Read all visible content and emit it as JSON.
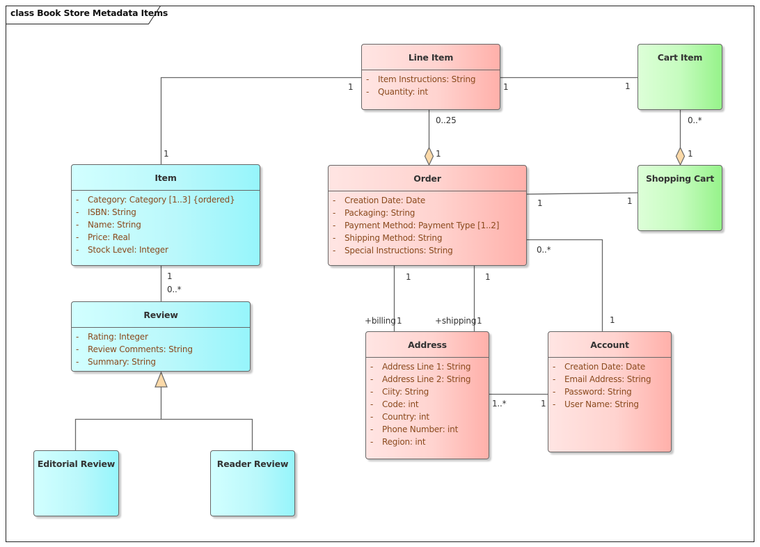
{
  "diagram": {
    "title": "class Book Store Metadata Items",
    "colors": {
      "entity_red": "#ffb0aa",
      "entity_teal": "#96f5fb",
      "entity_green": "#96f38a",
      "attribute_text": "#8a4a1e",
      "connector": "#666666",
      "aggregation_diamond": "#fbd9a8"
    }
  },
  "classes": {
    "line_item": {
      "name": "Line Item",
      "attributes": [
        {
          "vis": "-",
          "text": "Item Instructions: String"
        },
        {
          "vis": "-",
          "text": "Quantity: int"
        }
      ]
    },
    "cart_item": {
      "name": "Cart Item",
      "attributes": []
    },
    "item": {
      "name": "Item",
      "attributes": [
        {
          "vis": "-",
          "text": "Category: Category [1..3] {ordered}"
        },
        {
          "vis": "-",
          "text": "ISBN: String"
        },
        {
          "vis": "-",
          "text": "Name: String"
        },
        {
          "vis": "-",
          "text": "Price: Real"
        },
        {
          "vis": "-",
          "text": "Stock Level: Integer"
        }
      ]
    },
    "order": {
      "name": "Order",
      "attributes": [
        {
          "vis": "-",
          "text": "Creation Date: Date"
        },
        {
          "vis": "-",
          "text": "Packaging: String"
        },
        {
          "vis": "-",
          "text": "Payment Method: Payment Type [1..2]"
        },
        {
          "vis": "-",
          "text": "Shipping Method: String"
        },
        {
          "vis": "-",
          "text": "Special Instructions: String"
        }
      ]
    },
    "shopping_cart": {
      "name": "Shopping Cart",
      "attributes": []
    },
    "review": {
      "name": "Review",
      "attributes": [
        {
          "vis": "-",
          "text": "Rating: Integer"
        },
        {
          "vis": "-",
          "text": "Review Comments: String"
        },
        {
          "vis": "-",
          "text": "Summary: String"
        }
      ]
    },
    "address": {
      "name": "Address",
      "attributes": [
        {
          "vis": "-",
          "text": "Address Line 1: String"
        },
        {
          "vis": "-",
          "text": "Address Line 2: String"
        },
        {
          "vis": "-",
          "text": "Ciity: String"
        },
        {
          "vis": "-",
          "text": "Code: int"
        },
        {
          "vis": "-",
          "text": "Country: int"
        },
        {
          "vis": "-",
          "text": "Phone Number: int"
        },
        {
          "vis": "-",
          "text": "Region: int"
        }
      ]
    },
    "account": {
      "name": "Account",
      "attributes": [
        {
          "vis": "-",
          "text": "Creation Date: Date"
        },
        {
          "vis": "-",
          "text": "Email Address: String"
        },
        {
          "vis": "-",
          "text": "Password: String"
        },
        {
          "vis": "-",
          "text": "User Name: String"
        }
      ]
    },
    "editorial_review": {
      "name": "Editorial Review",
      "attributes": []
    },
    "reader_review": {
      "name": "Reader Review",
      "attributes": []
    }
  },
  "connectors": {
    "item_lineitem": {
      "type": "association",
      "source_mult": "1",
      "target_mult": "1"
    },
    "lineitem_cartitem": {
      "type": "association",
      "source_mult": "1",
      "target_mult": "1"
    },
    "lineitem_order": {
      "type": "aggregation",
      "part_mult": "0..25",
      "whole_mult": "1"
    },
    "cartitem_shoppingcart": {
      "type": "aggregation",
      "part_mult": "0..*",
      "whole_mult": "1"
    },
    "order_shoppingcart": {
      "type": "association",
      "source_mult": "1",
      "target_mult": "1"
    },
    "order_account": {
      "type": "association",
      "source_mult": "0..*",
      "target_mult": "1"
    },
    "order_billing": {
      "type": "association",
      "source_mult": "1",
      "role": "+billing",
      "target_mult": "1"
    },
    "order_shipping": {
      "type": "association",
      "source_mult": "1",
      "role": "+shipping",
      "target_mult": "1"
    },
    "address_account": {
      "type": "association",
      "source_mult": "1..*",
      "target_mult": "1"
    },
    "item_review": {
      "type": "association",
      "source_mult": "1",
      "target_mult": "0..*"
    },
    "review_generalization": {
      "type": "generalization"
    }
  }
}
